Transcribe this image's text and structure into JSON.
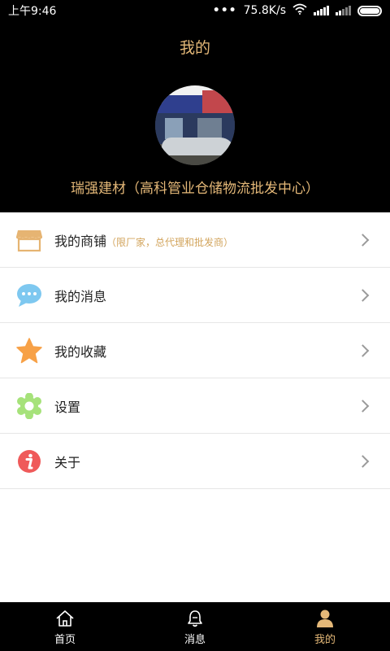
{
  "status_bar": {
    "time": "上午9:46",
    "net_speed": "75.8K/s"
  },
  "header": {
    "title": "我的",
    "company_name": "瑞强建材（高科管业仓储物流批发中心）"
  },
  "menu": {
    "items": [
      {
        "label": "我的商铺",
        "sub": "（限厂家，总代理和批发商）",
        "icon": "shop-icon"
      },
      {
        "label": "我的消息",
        "icon": "chat-bubble-icon"
      },
      {
        "label": "我的收藏",
        "icon": "star-icon"
      },
      {
        "label": "设置",
        "icon": "gear-icon"
      },
      {
        "label": "关于",
        "icon": "info-icon"
      }
    ]
  },
  "bottom_nav": {
    "items": [
      {
        "label": "首页",
        "icon": "home-icon"
      },
      {
        "label": "消息",
        "icon": "bell-icon"
      },
      {
        "label": "我的",
        "icon": "user-icon"
      }
    ],
    "active_index": 2
  },
  "colors": {
    "accent": "#e4b878",
    "header_bg": "#000000",
    "divider": "#e6e6e6"
  }
}
